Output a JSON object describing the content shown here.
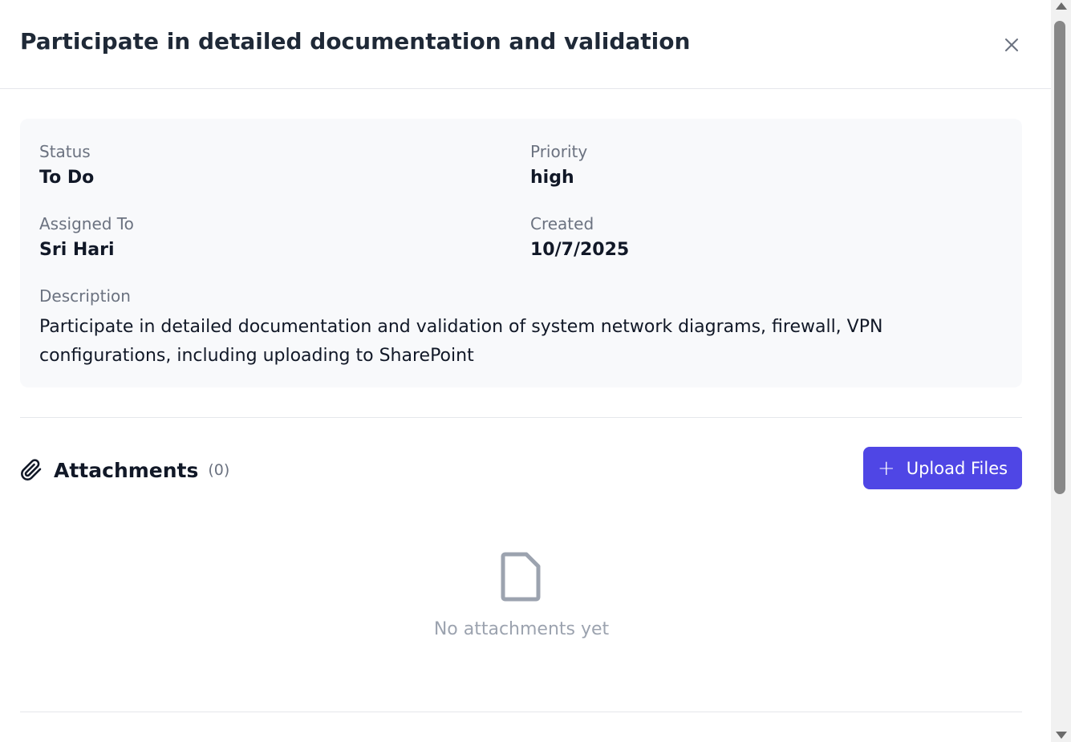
{
  "modal": {
    "title": "Participate in detailed documentation and validation",
    "close_icon": "close-icon"
  },
  "details": {
    "status_label": "Status",
    "status_value": "To Do",
    "priority_label": "Priority",
    "priority_value": "high",
    "assigned_label": "Assigned To",
    "assigned_value": "Sri Hari",
    "created_label": "Created",
    "created_value": "10/7/2025",
    "description_label": "Description",
    "description_value": "Participate in detailed documentation and validation of system network diagrams, firewall, VPN configurations, including uploading to SharePoint"
  },
  "attachments": {
    "icon": "paperclip-icon",
    "title": "Attachments",
    "count": "(0)",
    "upload_icon": "plus-icon",
    "upload_label": "Upload Files",
    "empty_icon": "document-icon",
    "empty_text": "No attachments yet"
  },
  "colors": {
    "accent": "#4f46e5",
    "card_background": "#f8f9fb",
    "muted_text": "#6b7280"
  }
}
